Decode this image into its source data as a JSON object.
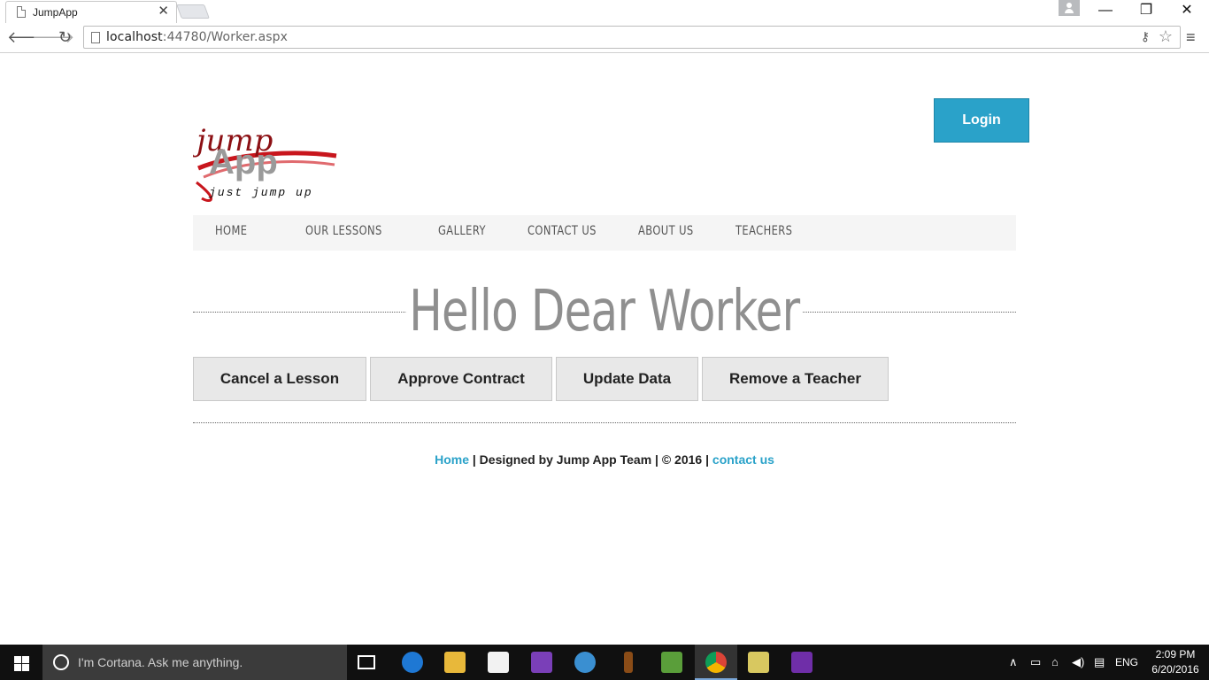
{
  "browser": {
    "tab_title": "JumpApp",
    "tab_close": "✕",
    "url_host": "localhost",
    "url_path": ":44780/Worker.aspx",
    "back_icon": "🡐",
    "forward_icon": "🡒",
    "reload_icon": "↻",
    "minimize": "—",
    "restore": "❐",
    "close": "✕"
  },
  "header": {
    "login_label": "Login",
    "logo_word1": "jump",
    "logo_word2": "App",
    "logo_tagline": "just jump up"
  },
  "nav": {
    "items": [
      "HOME",
      "OUR LESSONS",
      "GALLERY",
      "CONTACT US",
      "ABOUT US",
      "TEACHERS"
    ]
  },
  "main": {
    "heading": "Hello Dear Worker",
    "buttons": [
      "Cancel a Lesson",
      "Approve Contract",
      "Update Data",
      "Remove a Teacher"
    ]
  },
  "footer": {
    "home_link": "Home",
    "middle_text": " | Designed by Jump App Team | © 2016 | ",
    "contact_link": "contact us"
  },
  "taskbar": {
    "cortana_placeholder": "I'm Cortana. Ask me anything.",
    "language": "ENG",
    "time": "2:09 PM",
    "date": "6/20/2016"
  },
  "colors": {
    "accent": "#2aa2c9",
    "heading_gray": "#8f8f8f",
    "nav_bg": "#f5f5f5",
    "logo_red": "#c8161d"
  }
}
